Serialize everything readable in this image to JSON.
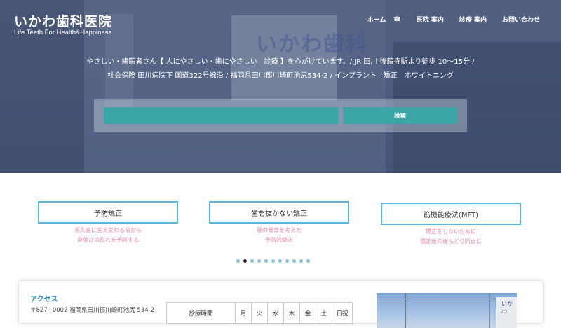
{
  "header": {
    "title": "いかわ歯科医院",
    "subtitle": "Life Teeth For Health&Happiness"
  },
  "nav": {
    "items": [
      {
        "label": "ホーム",
        "icon": "phone-icon",
        "icon_glyph": "☎"
      },
      {
        "label": "医院 案内"
      },
      {
        "label": "診療 案内"
      },
      {
        "label": "お問い合わせ"
      }
    ]
  },
  "hero": {
    "line1": "やさしい・歯医者さん【 人にやさしい・歯にやさしい　診療 】を心がけています。/ JR 田川 後藤寺駅より徒歩 10〜15分 /",
    "line2": "社会保険 田川病院下 国道322号線沿 / 福岡県田川郡川崎町池尻534-2 / インプラント　矯正　ホワイトニング",
    "sign": "いかわ歯科"
  },
  "search": {
    "placeholder": "",
    "button_label": "検索"
  },
  "cards": [
    {
      "title": "予防矯正",
      "desc1": "永久歯に生え変わる前から",
      "desc2": "歯並びの乱れを予防する"
    },
    {
      "title": "歯を抜かない矯正",
      "desc1": "顎の発育を考えた",
      "desc2": "予防的矯正"
    },
    {
      "title": "筋機能療法(MFT)",
      "desc1": "矯正をしないために",
      "desc2": "矯正後の後もどり防止に"
    }
  ],
  "carousel": {
    "count": 11,
    "active_index": 1
  },
  "access": {
    "title": "アクセス",
    "address": "〒827−0002  福岡県田川郡川崎町池尻 534-2",
    "table_header": [
      "診療時間",
      "月",
      "火",
      "水",
      "木",
      "金",
      "土",
      "日祝"
    ],
    "photo_sign": "いかわ"
  },
  "colors": {
    "accent_teal": "#3aa6a8",
    "card_border": "#5ab6d6",
    "card_desc": "#e987a8",
    "access_title": "#2a8fbf"
  }
}
